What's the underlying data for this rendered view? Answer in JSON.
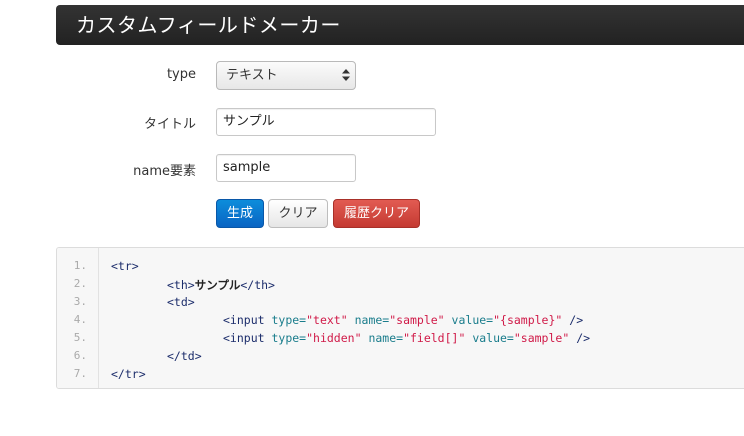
{
  "header": {
    "title": "カスタムフィールドメーカー"
  },
  "form": {
    "type_label": "type",
    "type_value": "テキスト",
    "title_label": "タイトル",
    "title_value": "サンプル",
    "name_label": "name要素",
    "name_value": "sample"
  },
  "buttons": {
    "generate": "生成",
    "clear": "クリア",
    "clear_history": "履歴クリア"
  },
  "code": {
    "line_numbers": [
      "1.",
      "2.",
      "3.",
      "4.",
      "5.",
      "6.",
      "7."
    ],
    "l1": "<tr>",
    "l2_open": "<th>",
    "l2_text": "サンプル",
    "l2_close": "</th>",
    "l3": "<td>",
    "l4_tag": "<input",
    "l4_type_attr": "type=",
    "l4_type_val": "\"text\"",
    "l4_name_attr": "name=",
    "l4_name_val": "\"sample\"",
    "l4_value_attr": "value=",
    "l4_value_val": "\"{sample}\"",
    "l4_end": "/>",
    "l5_tag": "<input",
    "l5_type_attr": "type=",
    "l5_type_val": "\"hidden\"",
    "l5_name_attr": "name=",
    "l5_name_val": "\"field[]\"",
    "l5_value_attr": "value=",
    "l5_value_val": "\"sample\"",
    "l5_end": "/>",
    "l6": "</td>",
    "l7": "</tr>"
  },
  "colors": {
    "header_bg": "#222222",
    "primary": "#0a6fd0",
    "danger": "#d0463e",
    "code_tag": "#1c2d6b",
    "code_attr": "#1a7d8c",
    "code_value": "#d01a48"
  }
}
